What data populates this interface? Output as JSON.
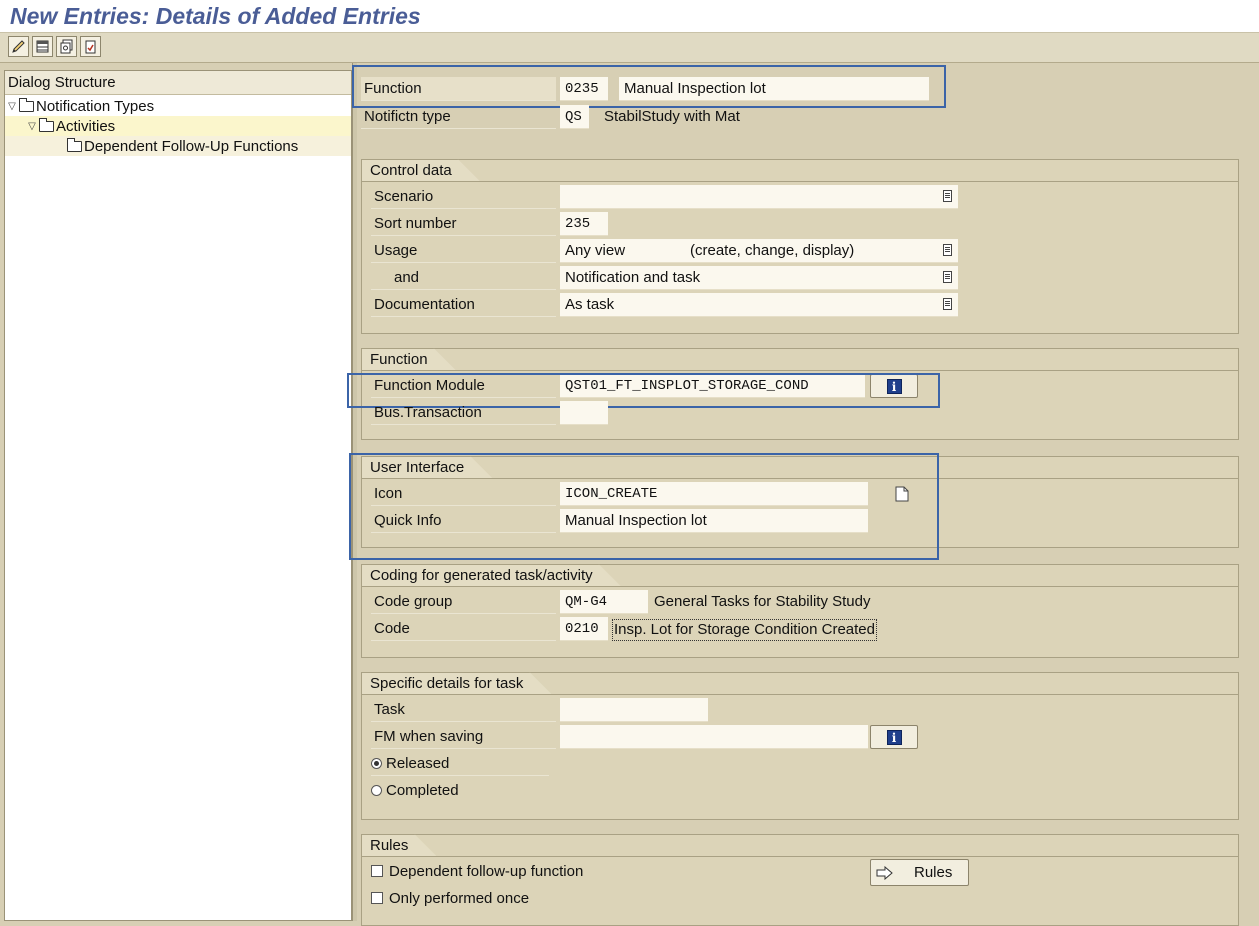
{
  "window": {
    "title": "New Entries: Details of Added Entries"
  },
  "toolbar": {
    "buttons": [
      "edit-pencil-icon",
      "table-view-icon",
      "copy-entry-icon",
      "delimit-icon"
    ]
  },
  "dialog_structure": {
    "header": "Dialog Structure",
    "items": [
      {
        "label": "Notification Types",
        "level": 0,
        "expanded": true,
        "selected": false
      },
      {
        "label": "Activities",
        "level": 1,
        "expanded": true,
        "selected": true
      },
      {
        "label": "Dependent Follow-Up Functions",
        "level": 2,
        "expanded": false,
        "selected": false
      }
    ]
  },
  "header_fields": {
    "function_label": "Function",
    "function_code": "0235",
    "function_text": "Manual Inspection lot",
    "notif_type_label": "Notifictn type",
    "notif_type_code": "QS",
    "notif_type_text": "StabilStudy with Mat"
  },
  "control_data": {
    "title": "Control data",
    "scenario_label": "Scenario",
    "scenario_value": "",
    "sort_label": "Sort number",
    "sort_value": "235",
    "usage_label": "Usage",
    "usage_value": "Any view",
    "usage_detail": "(create, change, display)",
    "and_label": "and",
    "and_value": "Notification and task",
    "doc_label": "Documentation",
    "doc_value": "As task"
  },
  "function_group": {
    "title": "Function",
    "fm_label": "Function Module",
    "fm_value": "QST01_FT_INSPLOT_STORAGE_COND",
    "bustrans_label": "Bus.Transaction",
    "bustrans_value": ""
  },
  "user_interface": {
    "title": "User Interface",
    "icon_label": "Icon",
    "icon_value": "ICON_CREATE",
    "quickinfo_label": "Quick Info",
    "quickinfo_value": "Manual Inspection lot"
  },
  "coding": {
    "title": "Coding for generated task/activity",
    "codegroup_label": "Code group",
    "codegroup_value": "QM-G4",
    "codegroup_text": "General Tasks for Stability Study",
    "code_label": "Code",
    "code_value": "0210",
    "code_text": "Insp. Lot for Storage Condition Created"
  },
  "task_details": {
    "title": "Specific details for task",
    "task_label": "Task",
    "task_value": "",
    "fm_saving_label": "FM when saving",
    "fm_saving_value": "",
    "released_label": "Released",
    "released_selected": true,
    "completed_label": "Completed",
    "completed_selected": false
  },
  "rules": {
    "title": "Rules",
    "dependent_label": "Dependent follow-up function",
    "dependent_checked": false,
    "once_label": "Only performed once",
    "once_checked": false,
    "rules_button": "Rules"
  },
  "colors": {
    "title": "#4a5d96",
    "background": "#d7cfb4",
    "highlight": "#3b64a8",
    "info_button": "#1f3f8c"
  }
}
